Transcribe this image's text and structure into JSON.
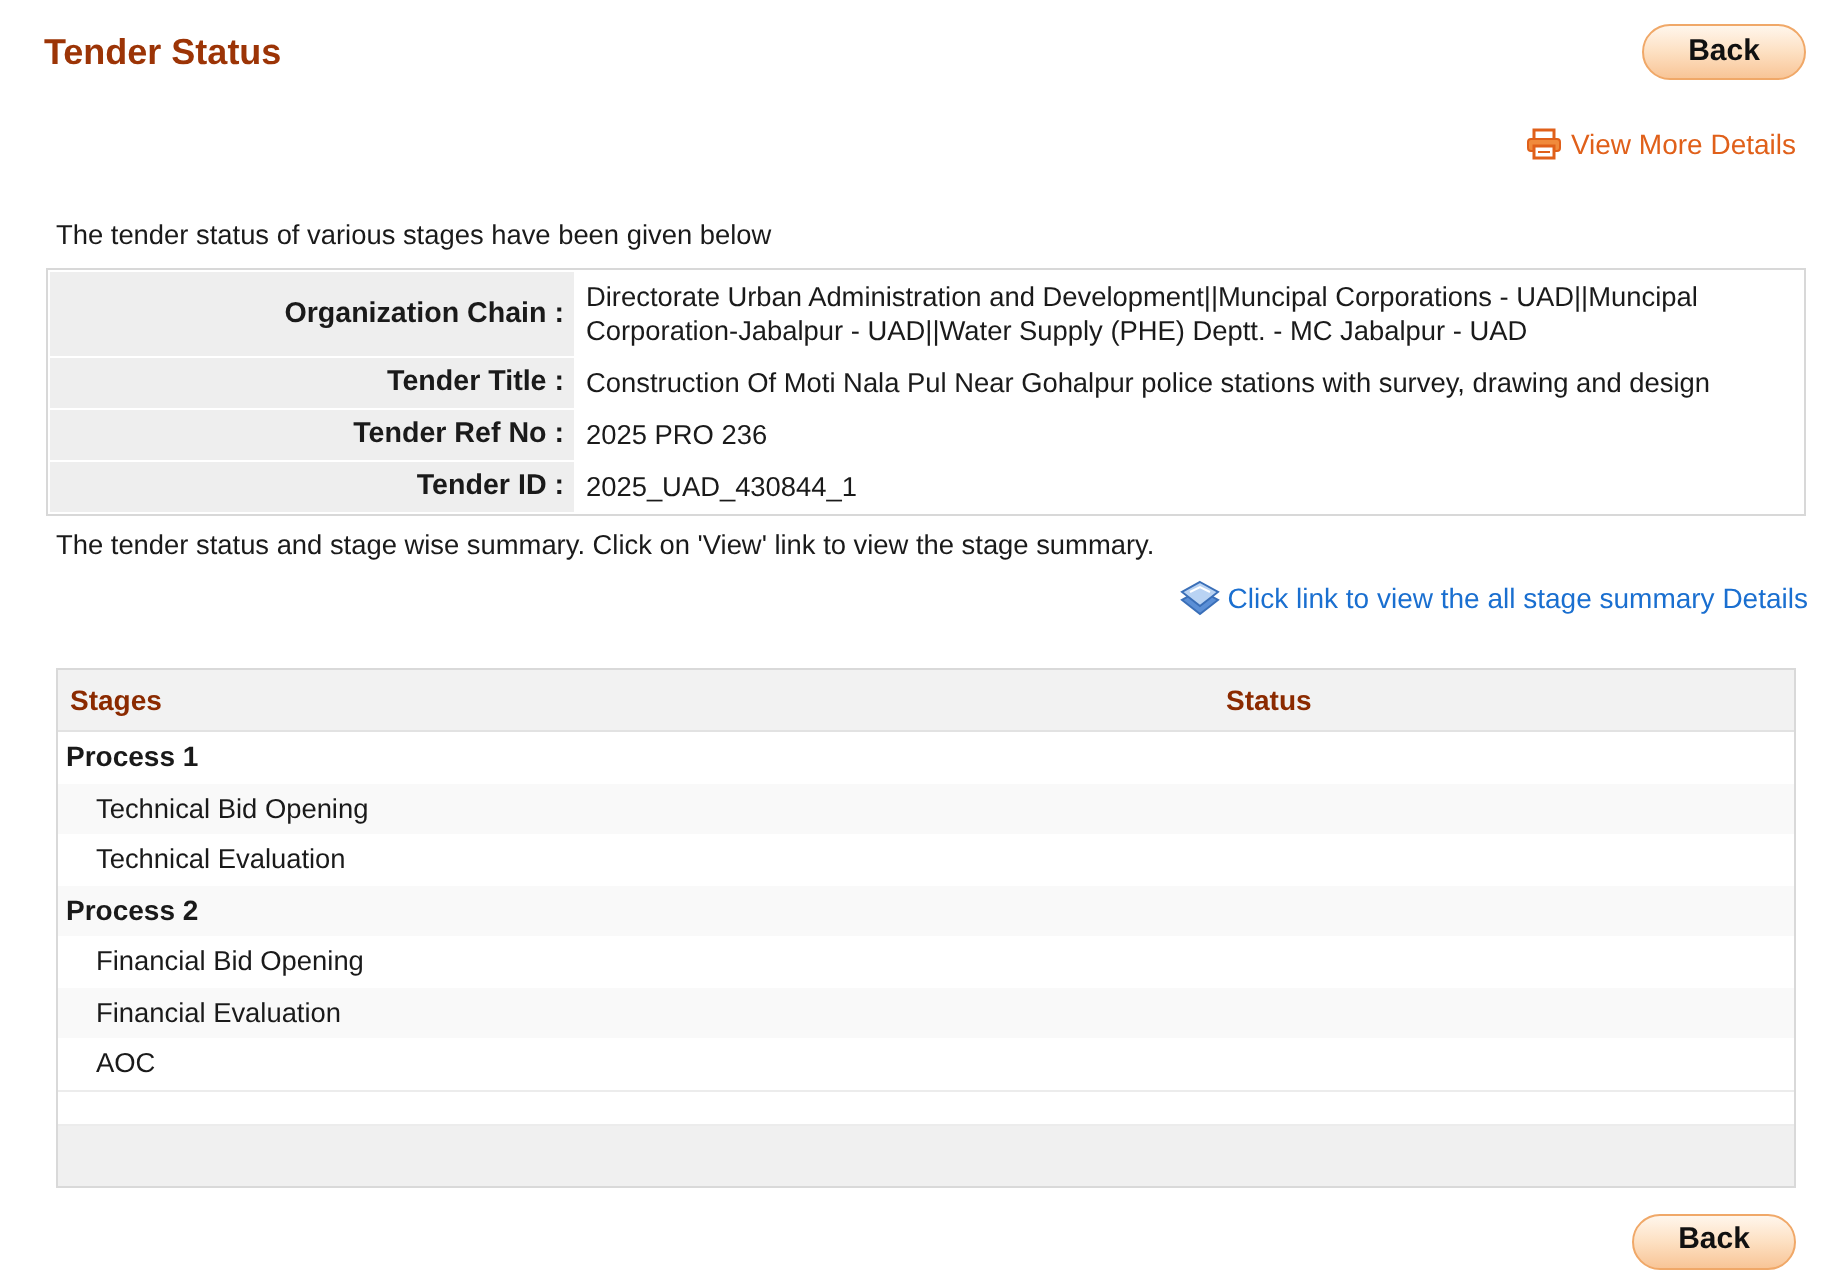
{
  "page": {
    "title": "Tender Status"
  },
  "top_back_button": {
    "label": "Back"
  },
  "view_more_link": {
    "label": "View More Details"
  },
  "intro_text": "The tender status of various stages have been given below",
  "tender_details": [
    {
      "label": "Organization Chain :",
      "value": "Directorate Urban Administration and Development||Muncipal Corporations - UAD||Muncipal Corporation-Jabalpur - UAD||Water Supply (PHE) Deptt. - MC Jabalpur - UAD"
    },
    {
      "label": "Tender Title :",
      "value": "Construction Of Moti Nala Pul Near Gohalpur police stations with survey, drawing and design"
    },
    {
      "label": "Tender Ref No :",
      "value": "2025 PRO 236"
    },
    {
      "label": "Tender ID :",
      "value": "2025_UAD_430844_1"
    }
  ],
  "summary_text": "The tender status and stage wise summary. Click on 'View' link to view the stage summary.",
  "stage_summary_link": {
    "label": "Click link to view the all stage summary Details"
  },
  "stages_table": {
    "columns": [
      "Stages",
      "Status"
    ],
    "rows": [
      {
        "label": "Process 1",
        "children": [
          {
            "label": "Technical Bid Opening"
          },
          {
            "label": "Technical Evaluation"
          }
        ]
      },
      {
        "label": "Process 2",
        "children": [
          {
            "label": "Financial Bid Opening"
          },
          {
            "label": "Financial Evaluation"
          },
          {
            "label": "AOC"
          }
        ]
      }
    ]
  },
  "bottom_back_button": {
    "label": "Back"
  }
}
